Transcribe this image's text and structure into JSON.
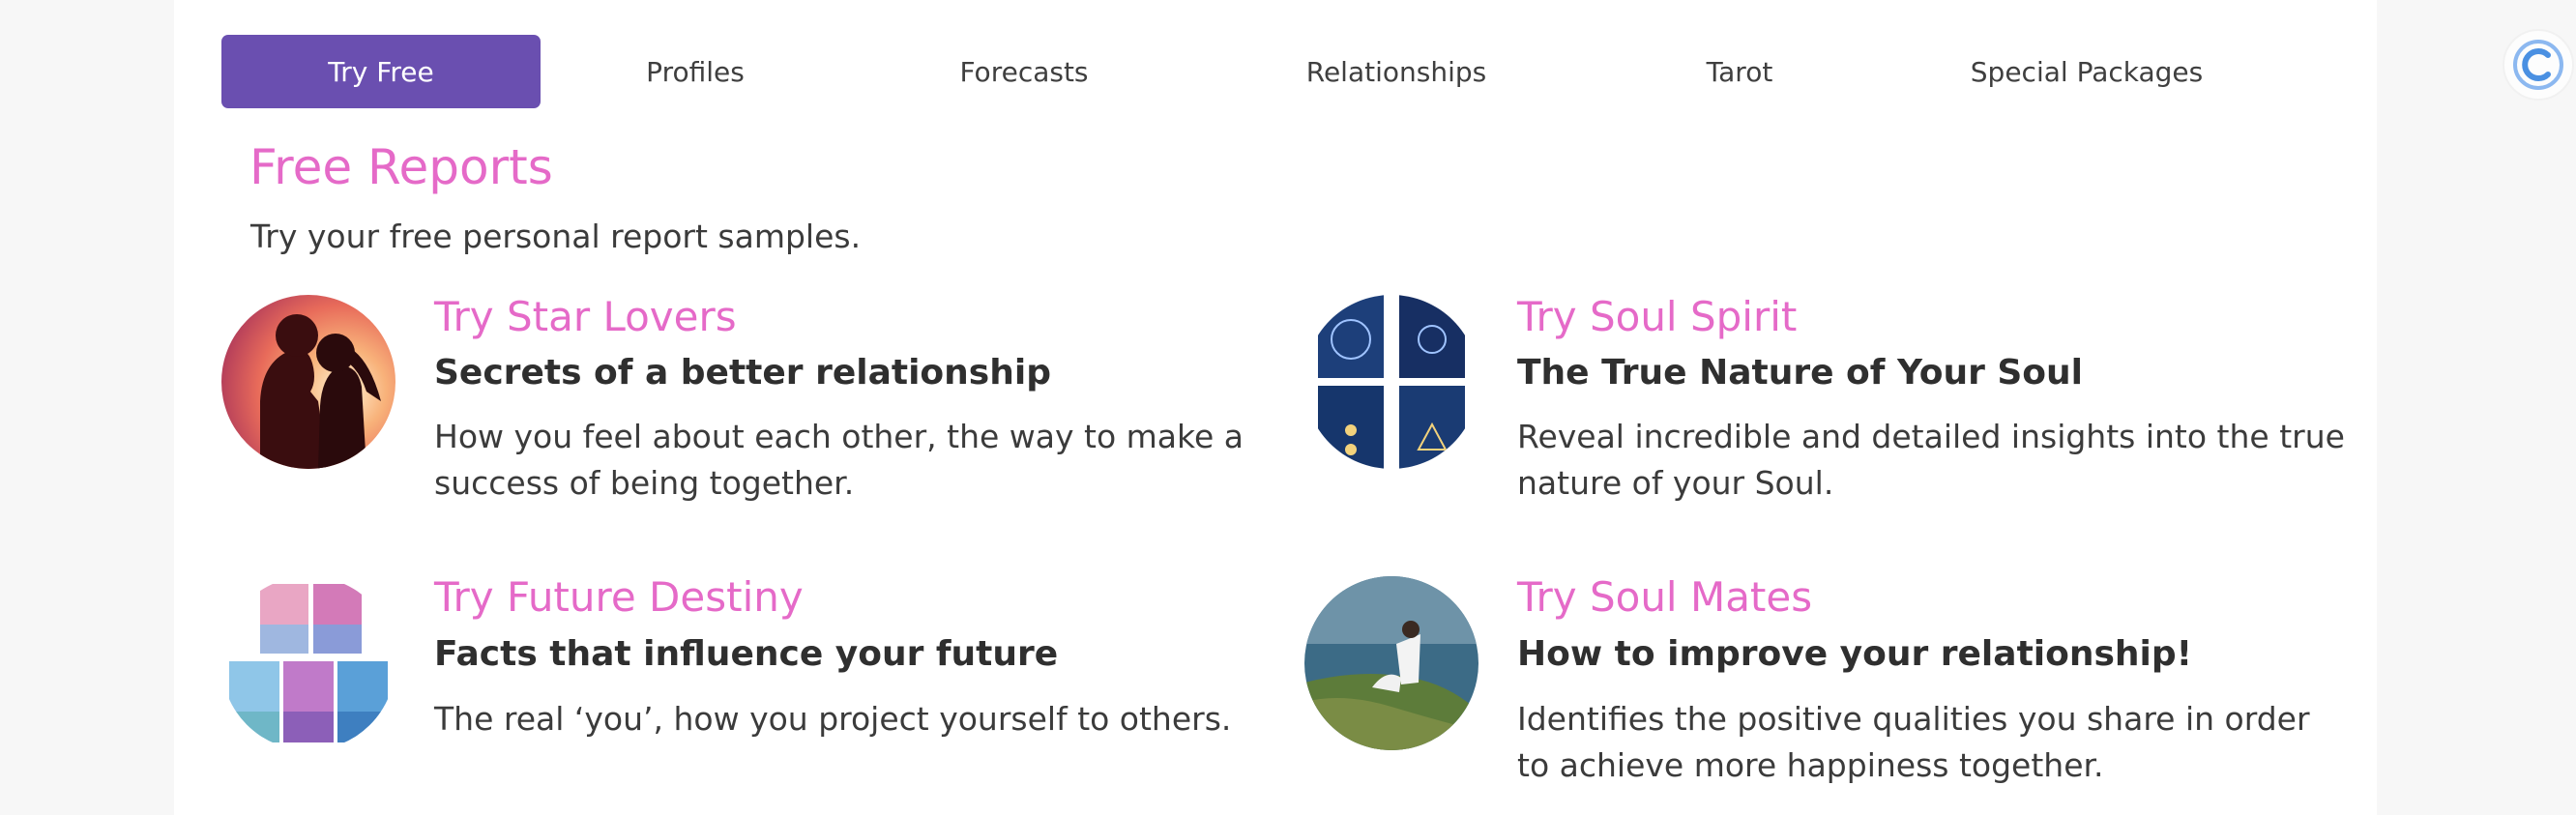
{
  "nav": {
    "tabs": [
      {
        "label": "Try Free",
        "active": true
      },
      {
        "label": "Profiles"
      },
      {
        "label": "Forecasts"
      },
      {
        "label": "Relationships"
      },
      {
        "label": "Tarot"
      },
      {
        "label": "Special Packages"
      }
    ]
  },
  "section": {
    "title": "Free Reports",
    "subtitle": "Try your free personal report samples."
  },
  "reports": [
    {
      "title": "Try Star Lovers",
      "headline": "Secrets of a better relationship",
      "description": "How you feel about each other, the way to make a success of being together.",
      "thumbnail": "silhouette-couple-sunset-image"
    },
    {
      "title": "Try Soul Spirit",
      "headline": "The True Nature of Your Soul",
      "description": "Reveal incredible and detailed insights into the true nature of your Soul.",
      "thumbnail": "soul-report-covers-image"
    },
    {
      "title": "Try Future Destiny",
      "headline": "Facts that influence your future",
      "description": "The real ‘you’, how you project yourself to others.",
      "thumbnail": "destiny-report-covers-image"
    },
    {
      "title": "Try Soul Mates",
      "headline": "How to improve your relationship!",
      "description": "Identifies the positive qualities you share in order to achieve more happiness together.",
      "thumbnail": "couple-on-cliff-image"
    }
  ],
  "colors": {
    "accent": "#e56ac8",
    "tab_active_bg": "#6a4fb0",
    "widget_blue": "#4a90e2"
  },
  "widget": {
    "icon": "assistant-c-icon"
  }
}
